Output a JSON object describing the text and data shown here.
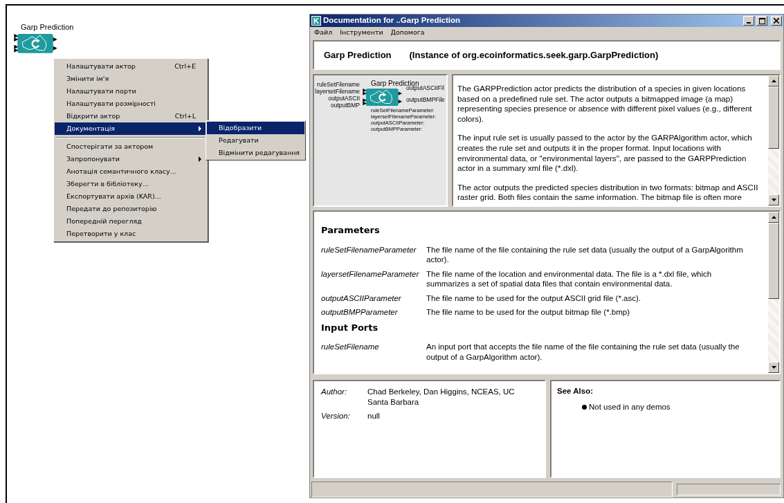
{
  "canvas": {
    "actor": {
      "label": "Garp Prediction"
    },
    "context_menu": {
      "items": [
        {
          "kind": "item",
          "label": "Налаштувати актор",
          "shortcut": "Ctrl+E",
          "has_submenu": false,
          "selected": false
        },
        {
          "kind": "item",
          "label": "Змінити ім'я",
          "has_submenu": false,
          "selected": false
        },
        {
          "kind": "item",
          "label": "Налаштувати порти",
          "has_submenu": false,
          "selected": false
        },
        {
          "kind": "item",
          "label": "Налаштувати розмірності",
          "has_submenu": false,
          "selected": false
        },
        {
          "kind": "item",
          "label": "Відкрити актор",
          "shortcut": "Ctrl+L",
          "has_submenu": false,
          "selected": false
        },
        {
          "kind": "item",
          "label": "Документація",
          "has_submenu": true,
          "selected": true
        },
        {
          "kind": "separator"
        },
        {
          "kind": "item",
          "label": "Спостерігати за актором",
          "has_submenu": false,
          "selected": false
        },
        {
          "kind": "item",
          "label": "Запропонувати",
          "has_submenu": true,
          "selected": false
        },
        {
          "kind": "item",
          "label": "Анотація семантичного класу...",
          "has_submenu": false,
          "selected": false
        },
        {
          "kind": "item",
          "label": "Зберегти в бібліотеку...",
          "has_submenu": false,
          "selected": false
        },
        {
          "kind": "item",
          "label": "Експортувати архів (KAR)...",
          "has_submenu": false,
          "selected": false
        },
        {
          "kind": "item",
          "label": "Передати до репозиторію",
          "has_submenu": false,
          "selected": false
        },
        {
          "kind": "item",
          "label": "Попередній перегляд",
          "has_submenu": false,
          "selected": false
        },
        {
          "kind": "item",
          "label": "Перетворити у клас",
          "has_submenu": false,
          "selected": false
        }
      ]
    },
    "submenu": {
      "items": [
        {
          "label": "Відобразити",
          "selected": true
        },
        {
          "label": "Редагувати",
          "selected": false
        },
        {
          "label": "Відмінити редагування",
          "selected": false
        }
      ]
    }
  },
  "doc_window": {
    "app_icon": "K",
    "title": "Documentation for ..Garp Prediction",
    "menu": [
      "Файл",
      "Інструменти",
      "Допомога"
    ],
    "header": {
      "name": "Garp Prediction",
      "instance": "(Instance of org.ecoinformatics.seek.garp.GarpPrediction)"
    },
    "preview": {
      "actor_label": "Garp Prediction",
      "input_ports": [
        "ruleSetFilename",
        "layersetFilename",
        "outputASCII",
        "outputBMP"
      ],
      "output_ports": [
        "outputASCIIFil",
        "outputBMPFile"
      ],
      "parameters": [
        "ruleSetFilenameParameter:",
        "layersetFilenameParameter:",
        "outputASCIIParameter:",
        "outputBMPParameter:"
      ]
    },
    "description": [
      "The GARPPrediction actor predicts the distribution of a species in given locations based on a predefined rule set. The actor outputs a bitmapped image (a map) representing species presence or absence with different pixel values (e.g., different colors).",
      "The input rule set is usually passed to the actor by the GARPAlgorithm actor, which creates the rule set and outputs it in the proper format. Input locations with environmental data, or \"environmental layers\", are passed to the GARPPrediction actor in a summary xml file (*.dxl).",
      "The actor outputs the predicted species distribution in two formats: bitmap and ASCII raster grid. Both files contain the same information. The bitmap file is often more"
    ],
    "sections": [
      {
        "title": "Parameters",
        "rows": [
          {
            "name": "ruleSetFilenameParameter",
            "description": "The file name of the file containing the rule set data (usually the output of a GarpAlgorithm actor)."
          },
          {
            "name": "layersetFilenameParameter",
            "description": "The file name of the location and environmental data. The file is a *.dxl file, which summarizes a set of spatial data files that contain environmental data."
          },
          {
            "name": "outputASCIIParameter",
            "description": "The file name to be used for the output ASCII grid file (*.asc)."
          },
          {
            "name": "outputBMPParameter",
            "description": "The file name to be used for the output bitmap file (*.bmp)"
          }
        ]
      },
      {
        "title": "Input Ports",
        "rows": [
          {
            "name": "ruleSetFilename",
            "description": "An input port that accepts the file name of the file containing the rule set data (usually the output of a GarpAlgorithm actor)."
          }
        ]
      }
    ],
    "info": [
      {
        "label": "Author:",
        "value": "Chad Berkeley, Dan Higgins, NCEAS, UC Santa Barbara"
      },
      {
        "label": "Version:",
        "value": "null"
      }
    ],
    "see_also": {
      "title": "See Also:",
      "items": [
        "Not used in any demos"
      ]
    }
  }
}
